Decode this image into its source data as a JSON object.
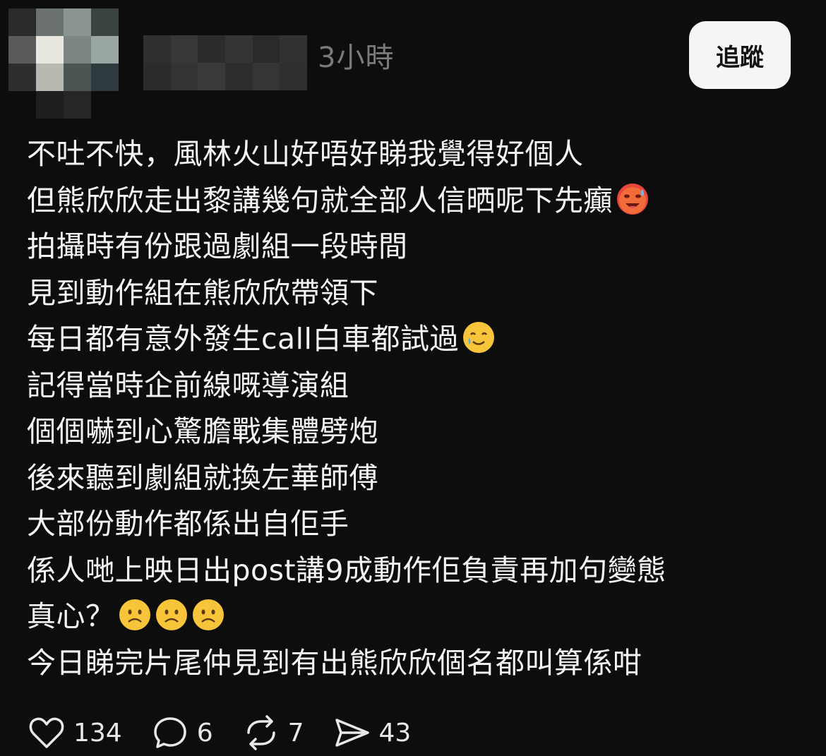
{
  "header": {
    "time": "3小時",
    "follow_label": "追蹤"
  },
  "post": {
    "lines": [
      "不吐不快，風林火山好唔好睇我覺得好個人",
      "但熊欣欣走出黎講幾句就全部人信晒呢下先癲",
      "拍攝時有份跟過劇組一段時間",
      "見到動作組在熊欣欣帶領下",
      "每日都有意外發生call白車都試過",
      "記得當時企前線嘅導演組",
      "個個嚇到心驚膽戰集體劈炮",
      "後來聽到劇組就換左華師傅",
      "大部份動作都係出自佢手",
      "係人哋上映日出post講9成動作佢負責再加句變態",
      "真心？",
      "今日睇完片尾仲見到有出熊欣欣個名都叫算係咁"
    ]
  },
  "icons": {
    "line2_emoji": "hot-face-emoji",
    "line5_emoji": "smiling-face-with-tear-emoji",
    "line11_emoji": "frowning-face-emoji"
  },
  "stats": {
    "likes": "134",
    "replies": "6",
    "reposts": "7",
    "shares": "43"
  },
  "colors": {
    "background": "#0d0d0d",
    "text": "#f4f4f4",
    "muted": "#7a7a7a",
    "button_bg": "#f5f5f5"
  }
}
